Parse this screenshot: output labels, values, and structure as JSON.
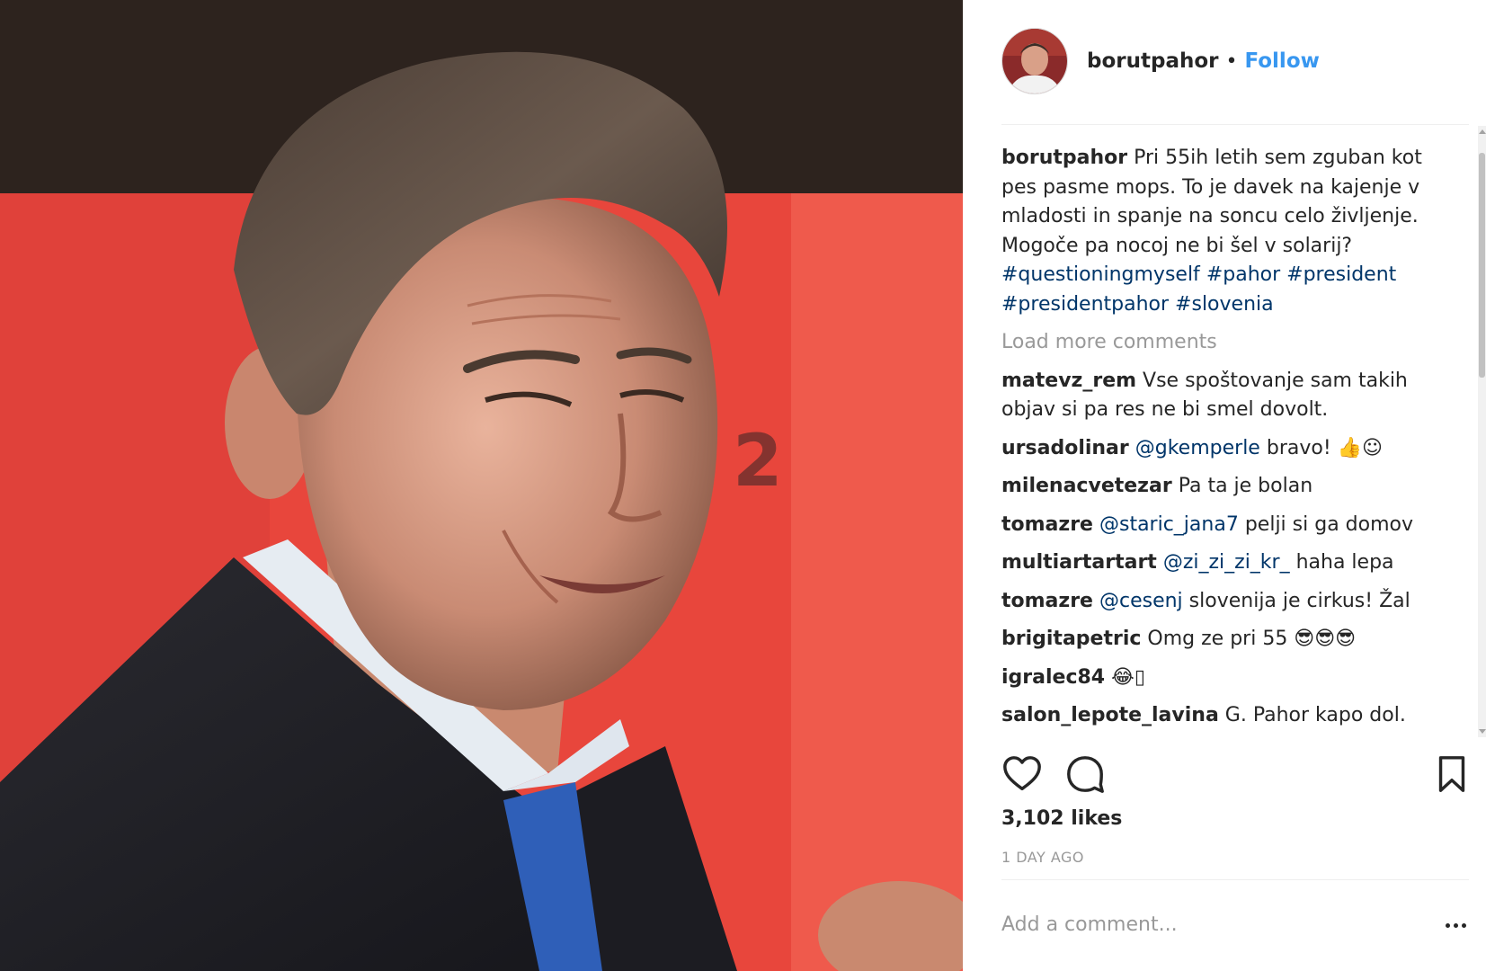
{
  "header": {
    "username": "borutpahor",
    "separator": "•",
    "follow_label": "Follow"
  },
  "caption": {
    "username": "borutpahor",
    "text": "Pri 55ih letih sem zguban kot pes pasme mops. To je davek na kajenje v mladosti in spanje na soncu celo življenje. Mogoče pa nocoj ne bi šel v solarij?",
    "hashtags": [
      "#questioningmyself",
      "#pahor",
      "#president",
      "#presidentpahor",
      "#slovenia"
    ]
  },
  "load_more_label": "Load more comments",
  "comments": [
    {
      "user": "matevz_rem",
      "mention": "",
      "text": "Vse spoštovanje sam takih objav si pa res ne bi smel dovolt."
    },
    {
      "user": "ursadolinar",
      "mention": "@gkemperle",
      "text": "bravo! 👍☺"
    },
    {
      "user": "milenacvetezar",
      "mention": "",
      "text": "Pa ta je bolan"
    },
    {
      "user": "tomazre",
      "mention": "@staric_jana7",
      "text": "pelji si ga domov"
    },
    {
      "user": "multiartartart",
      "mention": "@zi_zi_zi_kr_",
      "text": "haha lepa"
    },
    {
      "user": "tomazre",
      "mention": "@cesenj",
      "text": "slovenija je cirkus! Žal"
    },
    {
      "user": "brigitapetric",
      "mention": "",
      "text": "Omg ze pri 55 😎😎😎"
    },
    {
      "user": "igralec84",
      "mention": "",
      "text": "😂▯"
    },
    {
      "user": "salon_lepote_lavina",
      "mention": "",
      "text": "G. Pahor kapo dol."
    }
  ],
  "actions": {
    "like_icon": "heart-icon",
    "comment_icon": "comment-bubble-icon",
    "save_icon": "bookmark-icon"
  },
  "likes_label": "3,102 likes",
  "time_label": "1 DAY AGO",
  "add_comment_placeholder": "Add a comment...",
  "colors": {
    "accent": "#3897f0",
    "hashtag": "#003569",
    "muted": "#999999",
    "text": "#262626"
  }
}
